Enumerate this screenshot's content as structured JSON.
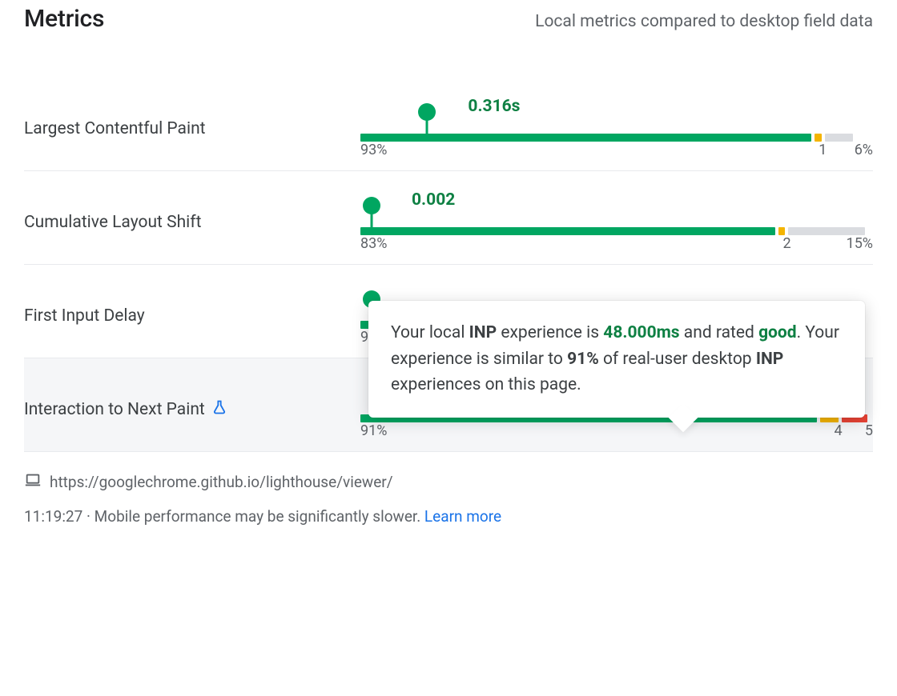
{
  "header": {
    "title": "Metrics",
    "subtitle": "Local metrics compared to desktop field data"
  },
  "metrics": [
    {
      "key": "lcp",
      "name": "Largest Contentful Paint",
      "value_label": "0.316s",
      "marker_pct": 13,
      "value_left_pct": 21,
      "good_w": 88,
      "ni_w": 1.3,
      "poor_w": 0,
      "grey_extra": 5.6,
      "pct_good": "93%",
      "pct_ni": "1",
      "pct_poor": "6%",
      "ni_right_edge_pct": 91
    },
    {
      "key": "cls",
      "name": "Cumulative Layout Shift",
      "value_label": "0.002",
      "marker_pct": 2.2,
      "value_left_pct": 10,
      "good_w": 81,
      "ni_w": 1.2,
      "poor_w": 0,
      "grey_extra": 15,
      "pct_good": "83%",
      "pct_ni": "2",
      "pct_poor": "15%",
      "ni_right_edge_pct": 84
    },
    {
      "key": "fid",
      "name": "First Input Delay",
      "value_label": "",
      "marker_pct": 2.2,
      "value_left_pct": 6,
      "good_w": 5,
      "ni_w": 0,
      "poor_w": 0,
      "grey_extra": 0,
      "pct_good": "9",
      "pct_ni": "",
      "pct_poor": "",
      "ni_right_edge_pct": 0
    },
    {
      "key": "inp",
      "name": "Interaction to Next Paint",
      "experimental": true,
      "value_label": "48.000ms",
      "marker_pct": 27,
      "value_left_pct": 33,
      "good_w": 89,
      "ni_w": 3.6,
      "poor_w": 5,
      "grey_extra": 0,
      "pct_good": "91%",
      "pct_ni": "4",
      "pct_poor": "5",
      "ni_right_edge_pct": 94
    }
  ],
  "tooltip": {
    "t1": "Your local ",
    "abbr1": "INP",
    "t2": " experience is ",
    "value": "48.000ms",
    "t3": " and rated ",
    "rating": "good",
    "t4": ". Your experience is similar to ",
    "similar_pct": "91%",
    "t5": " of real-user desktop ",
    "abbr2": "INP",
    "t6": " experiences on this page."
  },
  "footer": {
    "url": "https://googlechrome.github.io/lighthouse/viewer/",
    "time": "11:19:27",
    "sep": " · ",
    "note": "Mobile performance may be significantly slower. ",
    "link": "Learn more"
  }
}
